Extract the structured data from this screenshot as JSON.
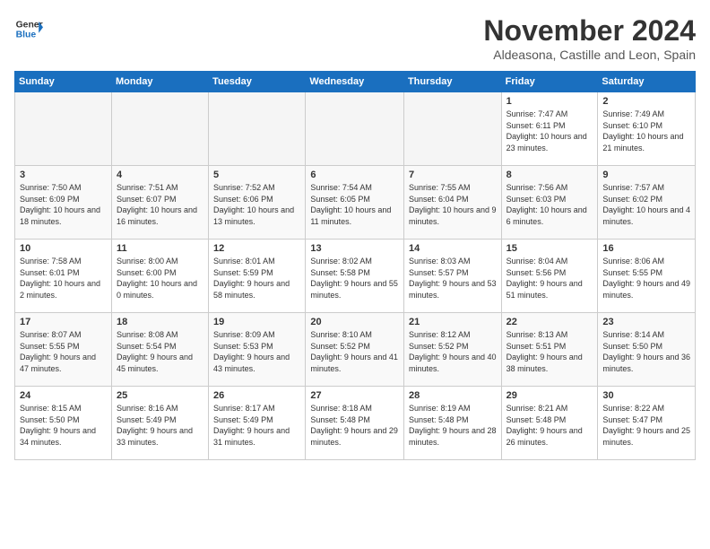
{
  "header": {
    "logo_line1": "General",
    "logo_line2": "Blue",
    "month_title": "November 2024",
    "subtitle": "Aldeasona, Castille and Leon, Spain"
  },
  "days_of_week": [
    "Sunday",
    "Monday",
    "Tuesday",
    "Wednesday",
    "Thursday",
    "Friday",
    "Saturday"
  ],
  "weeks": [
    [
      {
        "num": "",
        "empty": true
      },
      {
        "num": "",
        "empty": true
      },
      {
        "num": "",
        "empty": true
      },
      {
        "num": "",
        "empty": true
      },
      {
        "num": "",
        "empty": true
      },
      {
        "num": "1",
        "info": "Sunrise: 7:47 AM\nSunset: 6:11 PM\nDaylight: 10 hours and 23 minutes."
      },
      {
        "num": "2",
        "info": "Sunrise: 7:49 AM\nSunset: 6:10 PM\nDaylight: 10 hours and 21 minutes."
      }
    ],
    [
      {
        "num": "3",
        "info": "Sunrise: 7:50 AM\nSunset: 6:09 PM\nDaylight: 10 hours and 18 minutes."
      },
      {
        "num": "4",
        "info": "Sunrise: 7:51 AM\nSunset: 6:07 PM\nDaylight: 10 hours and 16 minutes."
      },
      {
        "num": "5",
        "info": "Sunrise: 7:52 AM\nSunset: 6:06 PM\nDaylight: 10 hours and 13 minutes."
      },
      {
        "num": "6",
        "info": "Sunrise: 7:54 AM\nSunset: 6:05 PM\nDaylight: 10 hours and 11 minutes."
      },
      {
        "num": "7",
        "info": "Sunrise: 7:55 AM\nSunset: 6:04 PM\nDaylight: 10 hours and 9 minutes."
      },
      {
        "num": "8",
        "info": "Sunrise: 7:56 AM\nSunset: 6:03 PM\nDaylight: 10 hours and 6 minutes."
      },
      {
        "num": "9",
        "info": "Sunrise: 7:57 AM\nSunset: 6:02 PM\nDaylight: 10 hours and 4 minutes."
      }
    ],
    [
      {
        "num": "10",
        "info": "Sunrise: 7:58 AM\nSunset: 6:01 PM\nDaylight: 10 hours and 2 minutes."
      },
      {
        "num": "11",
        "info": "Sunrise: 8:00 AM\nSunset: 6:00 PM\nDaylight: 10 hours and 0 minutes."
      },
      {
        "num": "12",
        "info": "Sunrise: 8:01 AM\nSunset: 5:59 PM\nDaylight: 9 hours and 58 minutes."
      },
      {
        "num": "13",
        "info": "Sunrise: 8:02 AM\nSunset: 5:58 PM\nDaylight: 9 hours and 55 minutes."
      },
      {
        "num": "14",
        "info": "Sunrise: 8:03 AM\nSunset: 5:57 PM\nDaylight: 9 hours and 53 minutes."
      },
      {
        "num": "15",
        "info": "Sunrise: 8:04 AM\nSunset: 5:56 PM\nDaylight: 9 hours and 51 minutes."
      },
      {
        "num": "16",
        "info": "Sunrise: 8:06 AM\nSunset: 5:55 PM\nDaylight: 9 hours and 49 minutes."
      }
    ],
    [
      {
        "num": "17",
        "info": "Sunrise: 8:07 AM\nSunset: 5:55 PM\nDaylight: 9 hours and 47 minutes."
      },
      {
        "num": "18",
        "info": "Sunrise: 8:08 AM\nSunset: 5:54 PM\nDaylight: 9 hours and 45 minutes."
      },
      {
        "num": "19",
        "info": "Sunrise: 8:09 AM\nSunset: 5:53 PM\nDaylight: 9 hours and 43 minutes."
      },
      {
        "num": "20",
        "info": "Sunrise: 8:10 AM\nSunset: 5:52 PM\nDaylight: 9 hours and 41 minutes."
      },
      {
        "num": "21",
        "info": "Sunrise: 8:12 AM\nSunset: 5:52 PM\nDaylight: 9 hours and 40 minutes."
      },
      {
        "num": "22",
        "info": "Sunrise: 8:13 AM\nSunset: 5:51 PM\nDaylight: 9 hours and 38 minutes."
      },
      {
        "num": "23",
        "info": "Sunrise: 8:14 AM\nSunset: 5:50 PM\nDaylight: 9 hours and 36 minutes."
      }
    ],
    [
      {
        "num": "24",
        "info": "Sunrise: 8:15 AM\nSunset: 5:50 PM\nDaylight: 9 hours and 34 minutes."
      },
      {
        "num": "25",
        "info": "Sunrise: 8:16 AM\nSunset: 5:49 PM\nDaylight: 9 hours and 33 minutes."
      },
      {
        "num": "26",
        "info": "Sunrise: 8:17 AM\nSunset: 5:49 PM\nDaylight: 9 hours and 31 minutes."
      },
      {
        "num": "27",
        "info": "Sunrise: 8:18 AM\nSunset: 5:48 PM\nDaylight: 9 hours and 29 minutes."
      },
      {
        "num": "28",
        "info": "Sunrise: 8:19 AM\nSunset: 5:48 PM\nDaylight: 9 hours and 28 minutes."
      },
      {
        "num": "29",
        "info": "Sunrise: 8:21 AM\nSunset: 5:48 PM\nDaylight: 9 hours and 26 minutes."
      },
      {
        "num": "30",
        "info": "Sunrise: 8:22 AM\nSunset: 5:47 PM\nDaylight: 9 hours and 25 minutes."
      }
    ]
  ]
}
